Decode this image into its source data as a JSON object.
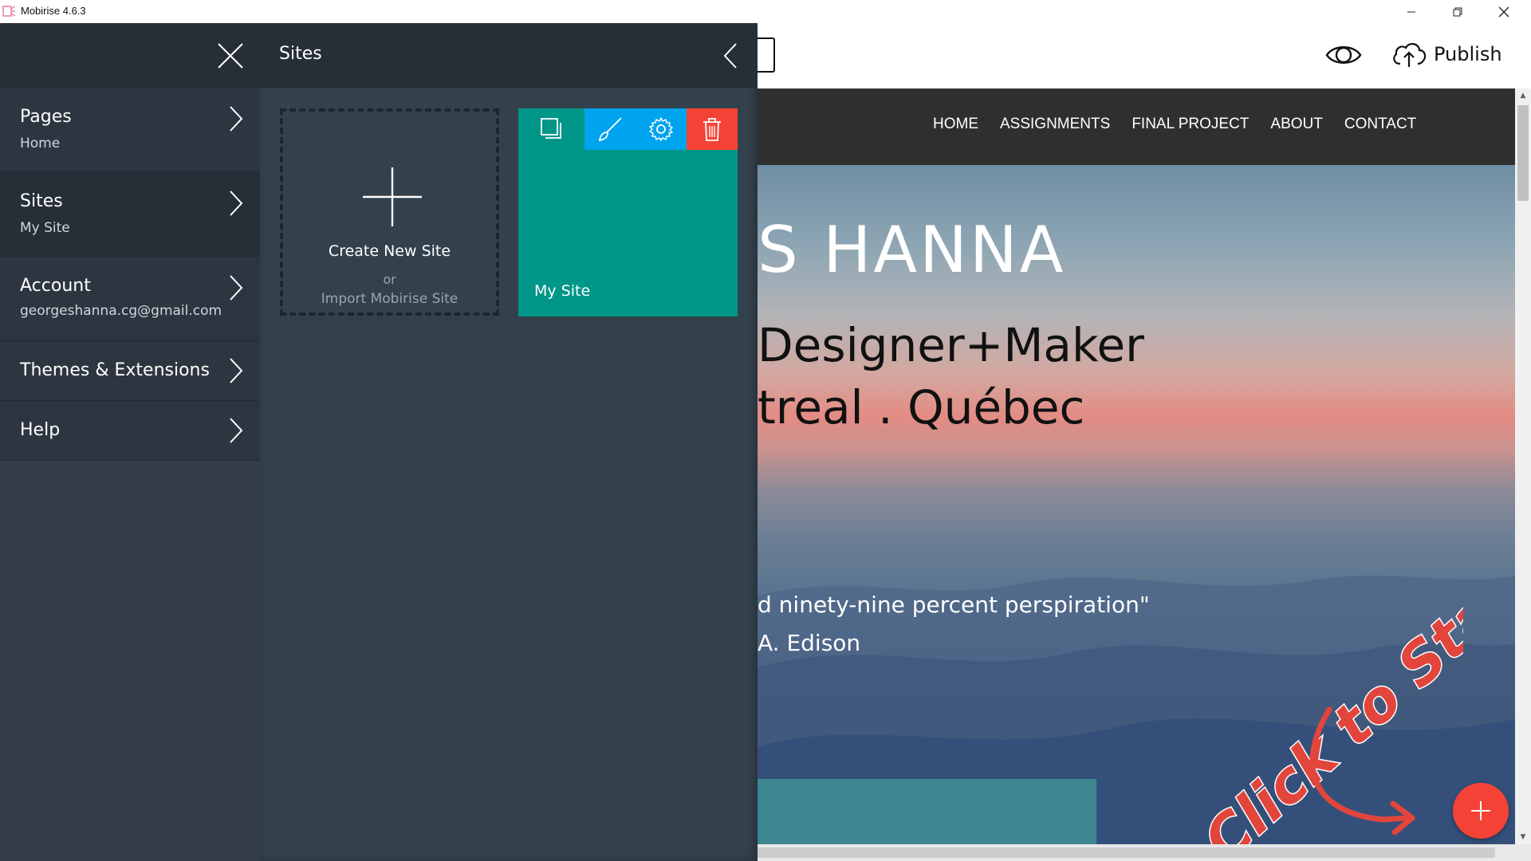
{
  "window": {
    "title": "Mobirise 4.6.3",
    "controls": [
      "minimize",
      "restore",
      "close"
    ]
  },
  "left_menu": {
    "items": [
      {
        "title": "Pages",
        "subtitle": "Home"
      },
      {
        "title": "Sites",
        "subtitle": "My Site",
        "active": true
      },
      {
        "title": "Account",
        "subtitle": "georgeshanna.cg@gmail.com"
      },
      {
        "title": "Themes & Extensions",
        "subtitle": ""
      },
      {
        "title": "Help",
        "subtitle": ""
      }
    ]
  },
  "sites_panel": {
    "title": "Sites",
    "create": {
      "label": "Create New Site",
      "or": "or",
      "import": "Import Mobirise Site"
    },
    "site_card": {
      "name": "My Site",
      "color": "#009688",
      "tools": [
        "duplicate-icon",
        "brush-icon",
        "gear-icon",
        "trash-icon"
      ]
    }
  },
  "toolbar": {
    "publish_label": "Publish",
    "icons": [
      "device-icon",
      "eye-icon",
      "cloud-upload-icon"
    ]
  },
  "site_preview": {
    "nav": [
      "HOME",
      "ASSIGNMENTS",
      "FINAL PROJECT",
      "ABOUT",
      "CONTACT"
    ],
    "hero": {
      "name": "S HANNA",
      "role": "Designer+Maker",
      "city": "treal . Québec",
      "quote": "d ninety-nine percent perspiration\"",
      "author": "A. Edison"
    },
    "overlay_text": "Click to Start"
  },
  "colors": {
    "accent_red": "#f44336",
    "accent_blue": "#00a4ee",
    "teal": "#009688",
    "panel_dark": "#262e37"
  }
}
